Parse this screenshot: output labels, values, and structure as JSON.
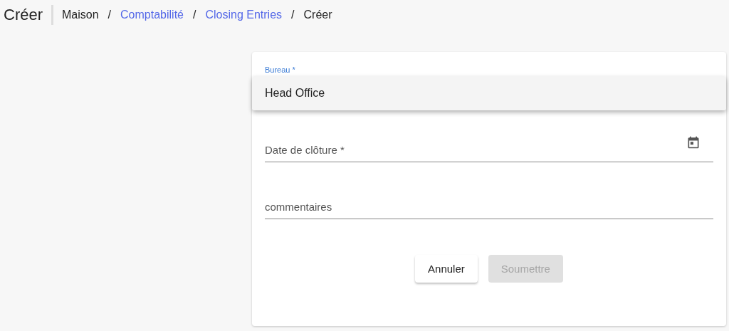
{
  "header": {
    "title": "Créer",
    "breadcrumb": [
      {
        "label": "Maison",
        "link": false
      },
      {
        "separator": "/",
        "label": "Comptabilité",
        "link": true
      },
      {
        "separator": "/",
        "label": "Closing Entries",
        "link": true
      },
      {
        "separator": "/",
        "label": "Créer",
        "link": false
      }
    ]
  },
  "form": {
    "fields": [
      {
        "kind": "select",
        "label": "Bureau *",
        "expanded": true,
        "options": [
          {
            "label": "Head Office"
          }
        ]
      },
      {
        "kind": "date",
        "placeholder": "Date de clôture *"
      },
      {
        "kind": "text",
        "placeholder": "commentaires"
      }
    ],
    "buttons": [
      {
        "label": "Annuler",
        "disabled": false
      },
      {
        "label": "Soumettre",
        "disabled": true
      }
    ]
  }
}
